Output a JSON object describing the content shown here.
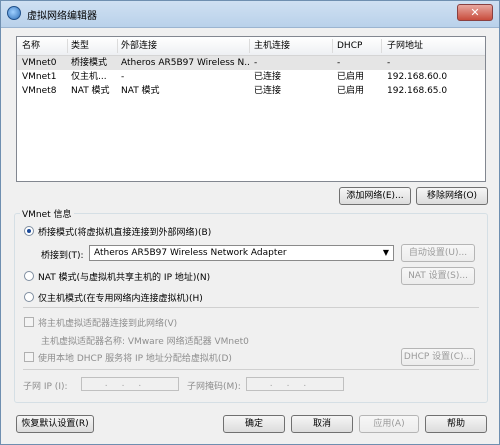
{
  "window": {
    "title": "虚拟网络编辑器",
    "close_glyph": "✕"
  },
  "table": {
    "headers": [
      "名称",
      "类型",
      "外部连接",
      "主机连接",
      "DHCP",
      "子网地址"
    ],
    "rows": [
      [
        "VMnet0",
        "桥接模式",
        "Atheros AR5B97 Wireless N...",
        "-",
        "-",
        "-"
      ],
      [
        "VMnet1",
        "仅主机...",
        "-",
        "已连接",
        "已启用",
        "192.168.60.0"
      ],
      [
        "VMnet8",
        "NAT 模式",
        "NAT 模式",
        "已连接",
        "已启用",
        "192.168.65.0"
      ]
    ],
    "selected_row": 0
  },
  "buttons": {
    "add_network": "添加网络(E)...",
    "remove_network": "移除网络(O)",
    "auto_settings": "自动设置(U)...",
    "nat_settings": "NAT 设置(S)...",
    "dhcp_settings": "DHCP 设置(C)...",
    "restore_defaults": "恢复默认设置(R)",
    "ok": "确定",
    "cancel": "取消",
    "apply": "应用(A)",
    "help": "帮助"
  },
  "vmnet_info": {
    "title": "VMnet 信息",
    "bridged_label": "桥接模式(将虚拟机直接连接到外部网络)(B)",
    "bridged_to_label": "桥接到(T):",
    "bridged_to_value": "Atheros AR5B97 Wireless Network Adapter",
    "nat_label": "NAT 模式(与虚拟机共享主机的 IP 地址)(N)",
    "hostonly_label": "仅主机模式(在专用网络内连接虚拟机)(H)",
    "selected_mode": "bridged",
    "connect_adapter_label": "将主机虚拟适配器连接到此网络(V)",
    "adapter_name_label": "主机虚拟适配器名称: VMware 网络适配器 VMnet0",
    "use_dhcp_label": "使用本地 DHCP 服务将 IP 地址分配给虚拟机(D)",
    "subnet_ip_label": "子网 IP (I):",
    "subnet_ip_value": "...",
    "subnet_mask_label": "子网掩码(M):",
    "subnet_mask_value": "..."
  }
}
